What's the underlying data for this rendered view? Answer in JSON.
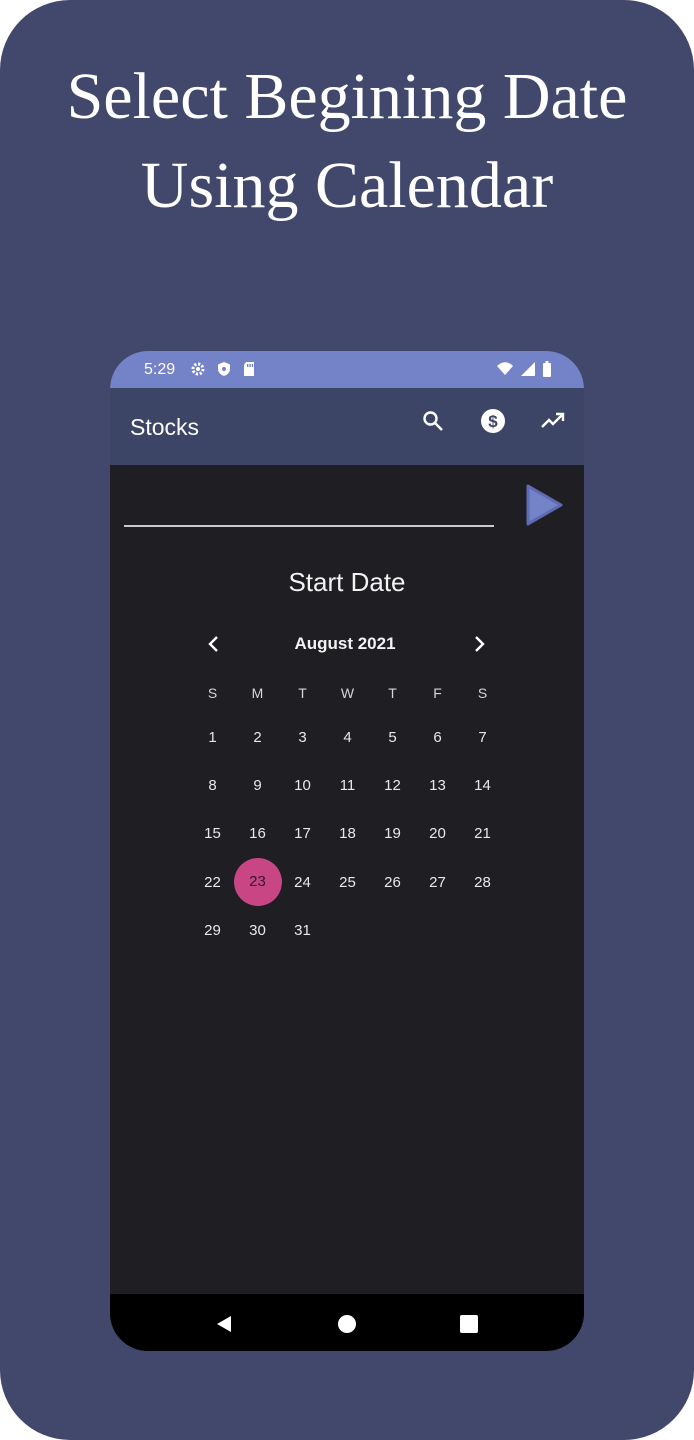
{
  "headline": {
    "line1": "Select Begining Date",
    "line2": "Using Calendar"
  },
  "status_bar": {
    "time": "5:29",
    "left_icons": [
      "gear-icon",
      "shield-icon",
      "sd-card-icon"
    ],
    "right_icons": [
      "wifi-icon",
      "cell-signal-icon",
      "battery-icon"
    ]
  },
  "app_bar": {
    "title": "Stocks",
    "actions": [
      "search-icon",
      "dollar-coin-icon",
      "trending-up-icon"
    ]
  },
  "symbol_input": {
    "value": "",
    "placeholder": ""
  },
  "go_button": {
    "icon": "play-arrow-icon"
  },
  "calendar": {
    "title": "Start Date",
    "month_label": "August 2021",
    "weekdays": [
      "S",
      "M",
      "T",
      "W",
      "T",
      "F",
      "S"
    ],
    "weeks": [
      [
        "1",
        "2",
        "3",
        "4",
        "5",
        "6",
        "7"
      ],
      [
        "8",
        "9",
        "10",
        "11",
        "12",
        "13",
        "14"
      ],
      [
        "15",
        "16",
        "17",
        "18",
        "19",
        "20",
        "21"
      ],
      [
        "22",
        "23",
        "24",
        "25",
        "26",
        "27",
        "28"
      ],
      [
        "29",
        "30",
        "31",
        "",
        "",
        "",
        ""
      ]
    ],
    "selected_day": "23",
    "selected_color": "#c94684"
  },
  "nav_bar": {
    "items": [
      "back-icon",
      "home-icon",
      "recents-icon"
    ]
  },
  "colors": {
    "frame_bg": "#41486c",
    "status_bar": "#7482c7",
    "app_bar": "#3d4566",
    "content_bg": "#1e1e23",
    "accent": "#7482c7"
  }
}
